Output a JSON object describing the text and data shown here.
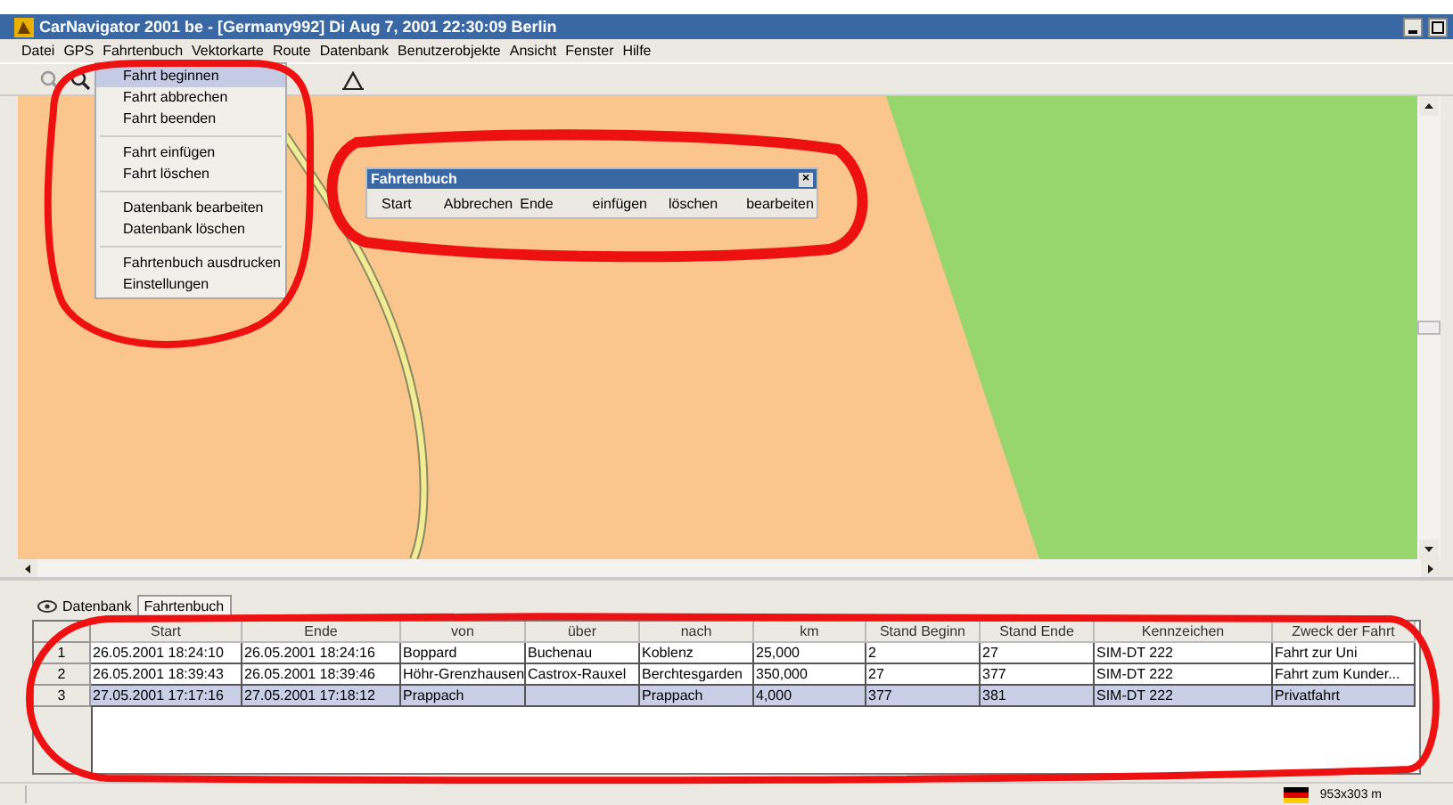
{
  "window": {
    "title": "CarNavigator 2001 be - [Germany992]  Di Aug 7, 2001   22:30:09 Berlin"
  },
  "menu": [
    "Datei",
    "GPS",
    "Fahrtenbuch",
    "Vektorkarte",
    "Route",
    "Datenbank",
    "Benutzerobjekte",
    "Ansicht",
    "Fenster",
    "Hilfe"
  ],
  "menu_dropdown": {
    "groups": [
      [
        {
          "label": "Fahrt beginnen",
          "selected": true
        },
        {
          "label": "Fahrt abbrechen",
          "selected": false
        },
        {
          "label": "Fahrt beenden",
          "selected": false
        }
      ],
      [
        {
          "label": "Fahrt einfügen",
          "selected": false
        },
        {
          "label": "Fahrt löschen",
          "selected": false
        }
      ],
      [
        {
          "label": "Datenbank bearbeiten",
          "selected": false
        },
        {
          "label": "Datenbank löschen",
          "selected": false
        }
      ],
      [
        {
          "label": "Fahrtenbuch ausdrucken",
          "selected": false
        },
        {
          "label": "Einstellungen",
          "selected": false
        }
      ]
    ]
  },
  "floating_toolbar": {
    "title": "Fahrtenbuch",
    "close": "×",
    "buttons": [
      "Start",
      "Abbrechen",
      "Ende",
      "einfügen",
      "löschen",
      "bearbeiten"
    ]
  },
  "bottom_tabs": [
    {
      "label": "Datenbank",
      "selected": false
    },
    {
      "label": "Fahrtenbuch",
      "selected": true
    }
  ],
  "table": {
    "columns": [
      "Start",
      "Ende",
      "von",
      "über",
      "nach",
      "km",
      "Stand Beginn",
      "Stand Ende",
      "Kennzeichen",
      "Zweck der Fahrt"
    ],
    "rows": [
      {
        "number": "1",
        "selected": false,
        "cells": [
          "26.05.2001 18:24:10",
          "26.05.2001 18:24:16",
          "Boppard",
          "Buchenau",
          "Koblenz",
          "25,000",
          "2",
          "27",
          "SIM-DT 222",
          "Fahrt zur Uni"
        ]
      },
      {
        "number": "2",
        "selected": false,
        "cells": [
          "26.05.2001 18:39:43",
          "26.05.2001 18:39:46",
          "Höhr-Grenzhausen",
          "Castrox-Rauxel",
          "Berchtesgarden",
          "350,000",
          "27",
          "377",
          "SIM-DT 222",
          "Fahrt zum Kunder..."
        ]
      },
      {
        "number": "3",
        "selected": true,
        "cells": [
          "27.05.2001 17:17:16",
          "27.05.2001 17:18:12",
          "Prappach",
          "",
          "Prappach",
          "4,000",
          "377",
          "381",
          "SIM-DT 222",
          "Privatfahrt"
        ]
      }
    ]
  },
  "status_bar": {
    "scale": "953x303 m"
  }
}
